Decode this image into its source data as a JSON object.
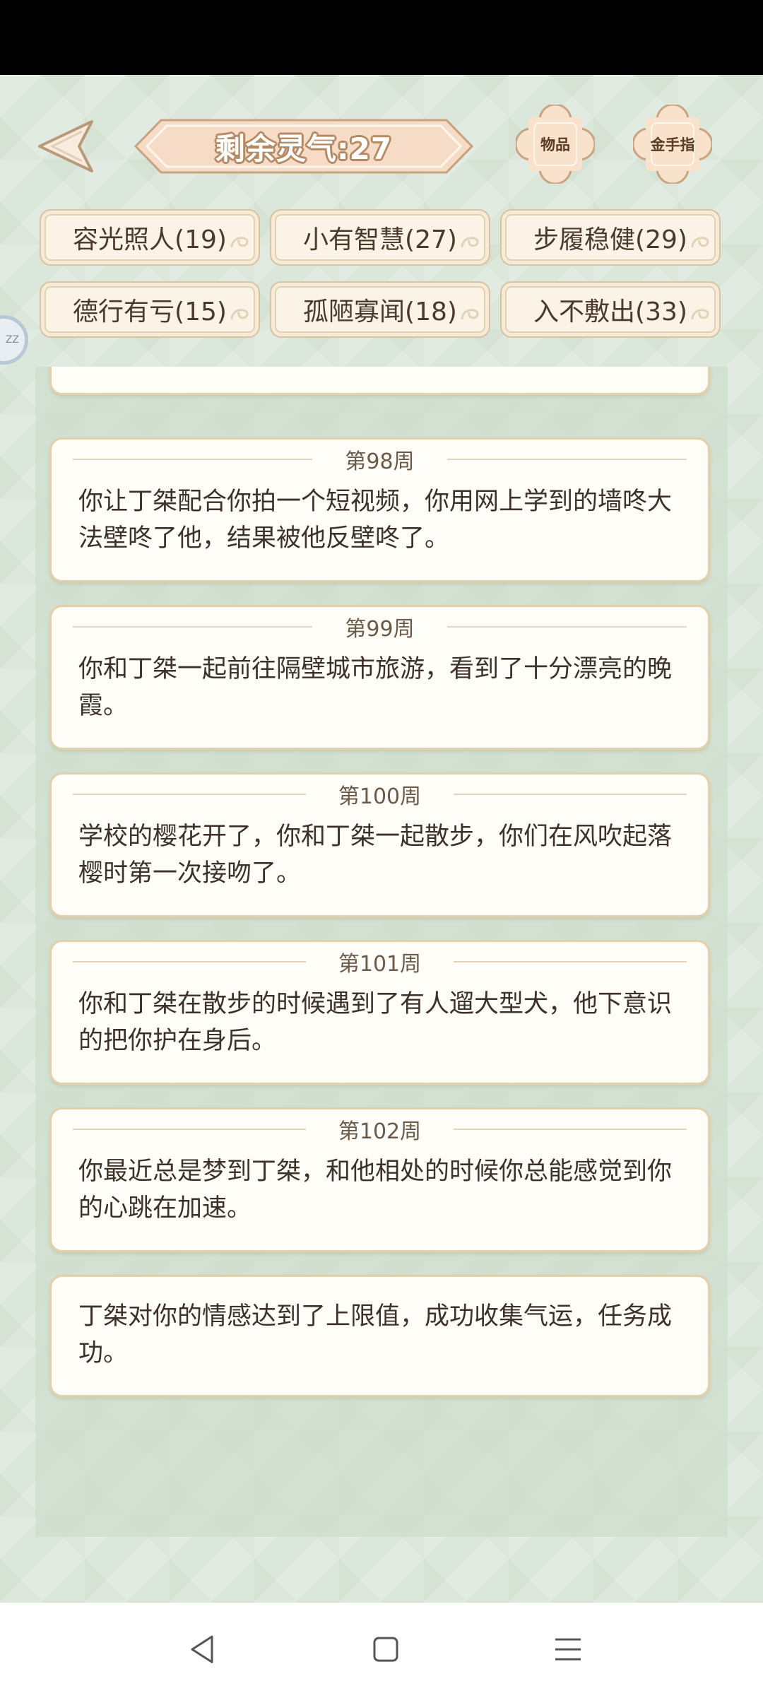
{
  "header": {
    "aura_label": "剩余灵气:27",
    "items_button": "物品",
    "cheat_button": "金手指"
  },
  "traits": [
    {
      "label": "容光照人(19)"
    },
    {
      "label": "小有智慧(27)"
    },
    {
      "label": "步履稳健(29)"
    },
    {
      "label": "德行有亏(15)"
    },
    {
      "label": "孤陋寡闻(18)"
    },
    {
      "label": "入不敷出(33)"
    }
  ],
  "side_float": {
    "label": "ZZ"
  },
  "log": [
    {
      "week": "第98周",
      "text": "你让丁桀配合你拍一个短视频，你用网上学到的墙咚大法壁咚了他，结果被他反壁咚了。"
    },
    {
      "week": "第99周",
      "text": "你和丁桀一起前往隔壁城市旅游，看到了十分漂亮的晚霞。"
    },
    {
      "week": "第100周",
      "text": "学校的樱花开了，你和丁桀一起散步，你们在风吹起落樱时第一次接吻了。"
    },
    {
      "week": "第101周",
      "text": "你和丁桀在散步的时候遇到了有人遛大型犬，他下意识的把你护在身后。"
    },
    {
      "week": "第102周",
      "text": "你最近总是梦到丁桀，和他相处的时候你总能感觉到你的心跳在加速。"
    },
    {
      "week": "",
      "text": "丁桀对你的情感达到了上限值，成功收集气运，任务成功。"
    }
  ],
  "colors": {
    "background": "#dce7db",
    "card_border": "#e3cfaa",
    "banner_fill": "#f6dcc6",
    "text": "#3d322a"
  },
  "icons": {
    "back": "back-arrow-icon",
    "nav_back": "triangle-back-icon",
    "nav_home": "square-home-icon",
    "nav_menu": "menu-lines-icon"
  }
}
